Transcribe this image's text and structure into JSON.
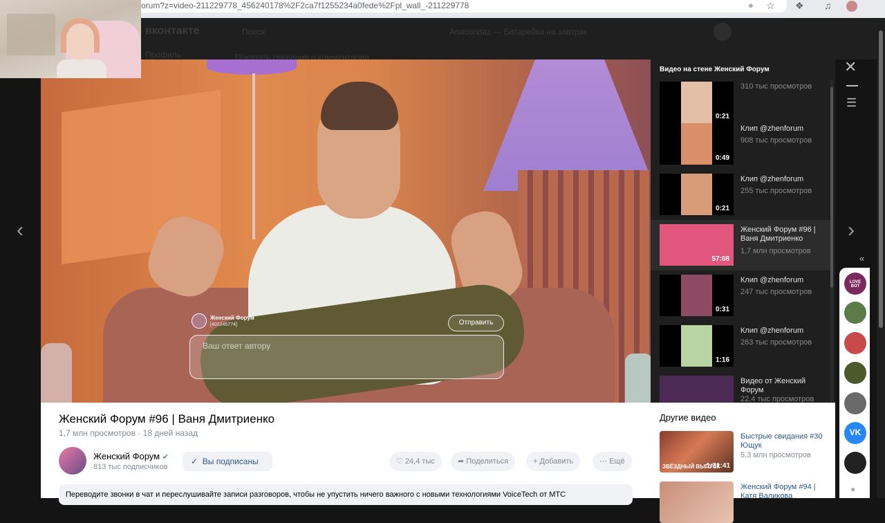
{
  "browser": {
    "url": "orum?z=video-211229778_456240178%2F2ca7f1255234a0fede%2Fpl_wall_-211229778",
    "icons": [
      "location-icon",
      "star-icon",
      "extensions-icon",
      "media-icon",
      "profile-icon"
    ]
  },
  "background_page": {
    "logo": "вконтакте",
    "search_placeholder": "Поиск",
    "menu_item": "Профиль",
    "music": "Anacondaz — Батарейки на завтрак",
    "notice": "Показать сведения о комментарии"
  },
  "player": {
    "reply_author": "Женский Форум",
    "reply_author_id": "[402245774]",
    "reply_placeholder": "Ваш ответ автору",
    "send_label": "Отправить"
  },
  "playlist": {
    "title": "Видео на стене Женский Форум",
    "items": [
      {
        "title": "",
        "views": "310 тыс просмотров",
        "duration": "0:21",
        "color": "#e2bfa6"
      },
      {
        "title": "Клип @zhenforum",
        "views": "908 тыс просмотров",
        "duration": "0:49",
        "color": "#d88f6a"
      },
      {
        "title": "Клип @zhenforum",
        "views": "255 тыс просмотров",
        "duration": "0:21",
        "color": "#d99c7a"
      },
      {
        "title": "Женский Форум #96 | Ваня Дмитриенко",
        "views": "1,7 млн просмотров",
        "duration": "57:08",
        "color": "#e0567c"
      },
      {
        "title": "Клип @zhenforum",
        "views": "247 тыс просмотров",
        "duration": "0:31",
        "color": "#8c4a63"
      },
      {
        "title": "Клип @zhenforum",
        "views": "263 тыс просмотров",
        "duration": "1:16",
        "color": "#b8d4a2"
      },
      {
        "title": "Видео от Женский Форум",
        "views": "22,4 тыс просмотров",
        "duration": "",
        "color": "#4b2a55"
      }
    ]
  },
  "video": {
    "title": "Женский Форум #96 | Ваня Дмитриенко",
    "views": "1,7 млн просмотров",
    "date": "18 дней назад",
    "channel": "Женский Форум",
    "subscribers": "813 тыс подписчиков",
    "subscribed_label": "Вы подписаны",
    "likes": "24,4 тыс",
    "share_label": "Поделиться",
    "add_label": "Добавить",
    "more_label": "Ещё",
    "promo": "Переводите звонки в чат и переслушивайте записи разговоров, чтобы не упустить ничего важного с новыми технологиями VoiceTech от МТС"
  },
  "other_videos": {
    "title": "Другие видео",
    "items": [
      {
        "title": "Быстрые свидания #30 Ющук",
        "views": "5,3 млн просмотров",
        "duration": "1:31:41",
        "badge": "ЗВЁЗДНЫЙ ВЫПУСК"
      },
      {
        "title": "Женский Форум #94 | Катя Валикова",
        "views": "",
        "duration": "",
        "badge": ""
      }
    ]
  },
  "friends": {
    "colors": [
      "#7b2a5c",
      "#5c7a4a",
      "#c84a4a",
      "#4a5a2a",
      "#6a6a6a",
      "#2787f5",
      "#222222"
    ],
    "logo_text": "LOVE BOT"
  }
}
